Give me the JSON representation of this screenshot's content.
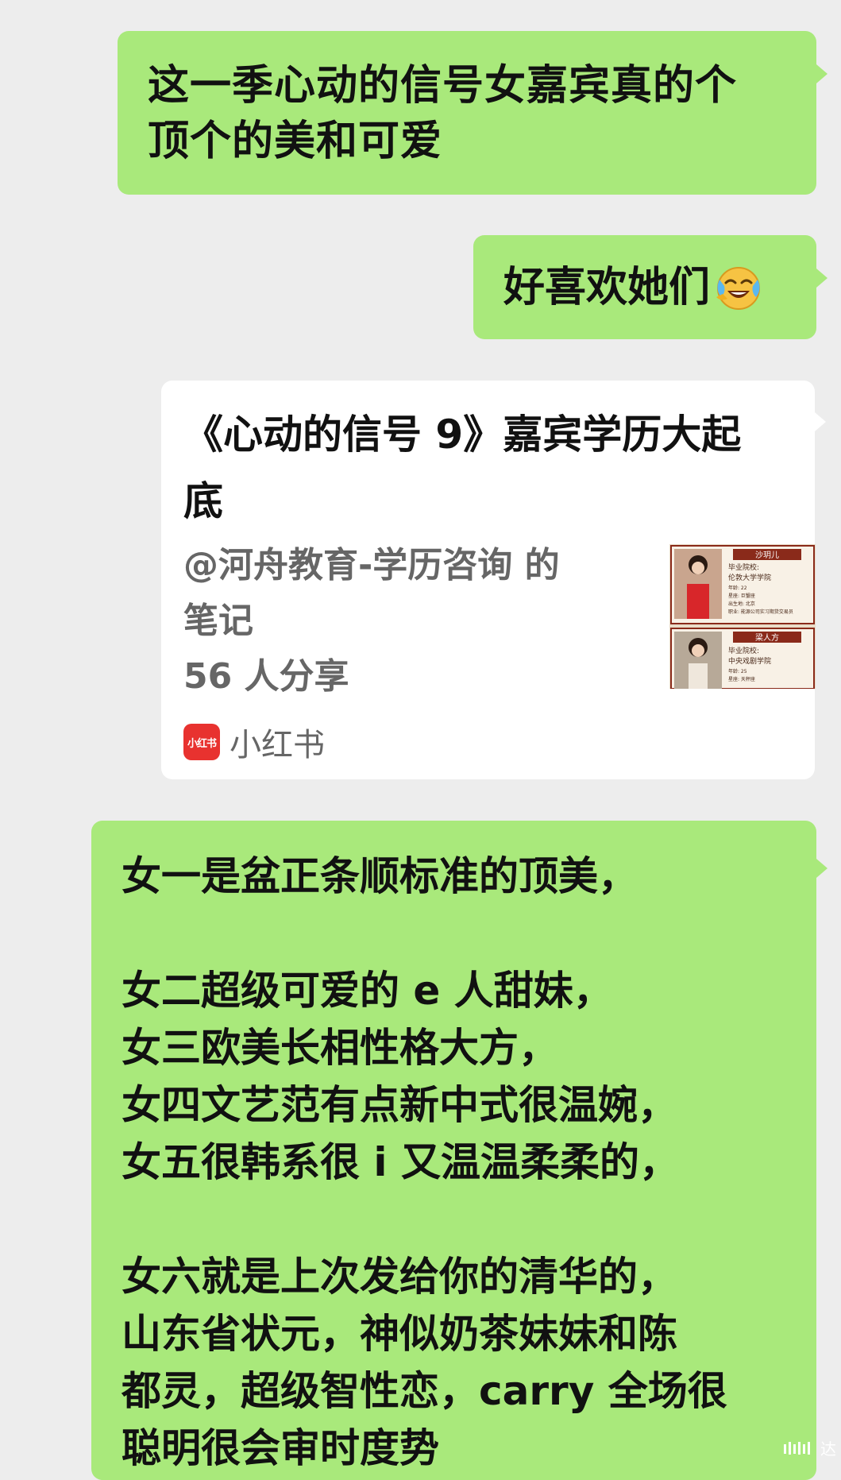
{
  "messages": {
    "m1": {
      "lines": [
        "这一季心动的信号女嘉宾真的个",
        "顶个的美和可爱"
      ]
    },
    "m2": {
      "text": "好喜欢她们",
      "emoji": "face-with-tears-of-joy"
    },
    "card": {
      "title_lines": [
        "《心动的信号 9》嘉宾学历大起",
        "底"
      ],
      "meta_lines": [
        "@河舟教育-学历咨询 的",
        "笔记",
        "56 人分享"
      ],
      "source_logo": "小红书",
      "source_label": "小红书",
      "thumbnail": {
        "top": {
          "name": "沙玥儿",
          "school_label": "毕业院校:",
          "school": "伦敦大学学院",
          "age": "年龄: 22",
          "place": "星座: 巨蟹座",
          "birthplace": "出生地: 北京",
          "job": "职业: 能源公司实习期货交易员"
        },
        "bottom": {
          "name": "梁人方",
          "school_label": "毕业院校:",
          "school": "中央戏剧学院",
          "age": "年龄: 25",
          "place": "星座: 天秤座"
        }
      }
    },
    "m4": {
      "para1": [
        "女一是盆正条顺标准的顶美，"
      ],
      "para2": [
        "女二超级可爱的 e 人甜妹，",
        "女三欧美长相性格大方，",
        "女四文艺范有点新中式很温婉，",
        "女五很韩系很 i 又温温柔柔的，"
      ],
      "para3": [
        "女六就是上次发给你的清华的，",
        "山东省状元，神似奶茶妹妹和陈",
        "都灵，超级智性恋，carry 全场很",
        "聪明很会审时度势"
      ]
    }
  },
  "watermark": {
    "text": "达",
    "color": "#ffffff"
  },
  "colors": {
    "background": "#ededed",
    "sent_bubble": "#a9e97b",
    "card_bubble": "#ffffff",
    "brand_red": "#e8322f"
  }
}
